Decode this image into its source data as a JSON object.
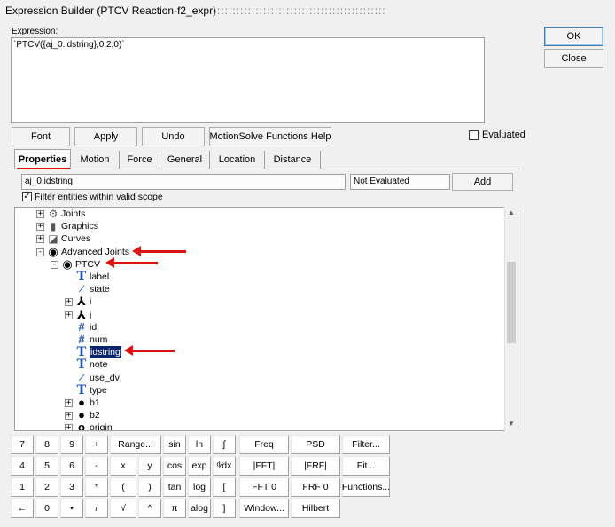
{
  "window": {
    "title": "Expression Builder (PTCV Reaction-f2_expr)",
    "title_decoration": ":::::::::::::::::::::::::::::::::::::::::::::::"
  },
  "dialog_buttons": {
    "ok": "OK",
    "close": "Close"
  },
  "expression": {
    "label": "Expression:",
    "value": "`PTCV({aj_0.idstring},0,2,0)`"
  },
  "toolbar": {
    "font": "Font",
    "apply": "Apply",
    "undo": "Undo",
    "functions_help": "MotionSolve Functions Help"
  },
  "evaluated": {
    "label": "Evaluated",
    "checked": false
  },
  "tabs": [
    {
      "label": "Properties",
      "active": true
    },
    {
      "label": "Motion",
      "active": false
    },
    {
      "label": "Force",
      "active": false
    },
    {
      "label": "General",
      "active": false
    },
    {
      "label": "Location",
      "active": false
    },
    {
      "label": "Distance",
      "active": false
    }
  ],
  "properties": {
    "entity_field": "aj_0.idstring",
    "eval_field": "Not Evaluated",
    "add_label": "Add",
    "filter_label": "Filter entities within valid scope",
    "filter_checked": true
  },
  "tree": [
    {
      "label": "Joints",
      "icon": "joints-icon",
      "glyph": "⚙",
      "depth": 0,
      "expander": "+"
    },
    {
      "label": "Graphics",
      "icon": "graphics-icon",
      "glyph": "▮",
      "depth": 0,
      "expander": "+"
    },
    {
      "label": "Curves",
      "icon": "curves-icon",
      "glyph": "◪",
      "depth": 0,
      "expander": "+"
    },
    {
      "label": "Advanced Joints",
      "icon": "advanced-joints-icon",
      "glyph": "◉",
      "depth": 0,
      "expander": "-"
    },
    {
      "label": "PTCV",
      "icon": "ptcv-icon",
      "glyph": "◉",
      "depth": 1,
      "expander": "-"
    },
    {
      "label": "label",
      "icon": "text-type-icon",
      "glyph": "T",
      "depth": 2,
      "expander": ""
    },
    {
      "label": "state",
      "icon": "boolean-type-icon",
      "glyph": "⁄",
      "depth": 2,
      "expander": ""
    },
    {
      "label": "i",
      "icon": "marker-icon",
      "glyph": "⅄",
      "depth": 2,
      "expander": "+"
    },
    {
      "label": "j",
      "icon": "marker-icon",
      "glyph": "⅄",
      "depth": 2,
      "expander": "+"
    },
    {
      "label": "id",
      "icon": "integer-type-icon",
      "glyph": "#",
      "depth": 2,
      "expander": ""
    },
    {
      "label": "num",
      "icon": "integer-type-icon",
      "glyph": "#",
      "depth": 2,
      "expander": ""
    },
    {
      "label": "idstring",
      "icon": "text-type-icon",
      "glyph": "T",
      "depth": 2,
      "expander": "",
      "selected": true
    },
    {
      "label": "note",
      "icon": "text-type-icon",
      "glyph": "T",
      "depth": 2,
      "expander": ""
    },
    {
      "label": "use_dv",
      "icon": "boolean-type-icon",
      "glyph": "⁄",
      "depth": 2,
      "expander": ""
    },
    {
      "label": "type",
      "icon": "text-type-icon",
      "glyph": "T",
      "depth": 2,
      "expander": ""
    },
    {
      "label": "b1",
      "icon": "body-icon",
      "glyph": "●",
      "depth": 2,
      "expander": "+"
    },
    {
      "label": "b2",
      "icon": "body-icon",
      "glyph": "●",
      "depth": 2,
      "expander": "+"
    },
    {
      "label": "origin",
      "icon": "point-icon",
      "glyph": "o",
      "depth": 2,
      "expander": "+"
    }
  ],
  "keypad": [
    [
      "7",
      "8",
      "9",
      "+",
      "Range...",
      "sin",
      "ln",
      "∫",
      "Freq",
      "PSD",
      "Filter..."
    ],
    [
      "4",
      "5",
      "6",
      "-",
      "x",
      "y",
      "cos",
      "exp",
      "ᵈ⁄dx",
      "|FFT|",
      "|FRF|",
      "Fit..."
    ],
    [
      "1",
      "2",
      "3",
      "*",
      "(",
      ")",
      "tan",
      "log",
      "[",
      "FFT 0",
      "FRF 0",
      "Functions..."
    ],
    [
      "←",
      "0",
      "•",
      "/",
      "√",
      "^",
      "π",
      "alog",
      "]",
      "Window...",
      "Hilbert"
    ]
  ]
}
